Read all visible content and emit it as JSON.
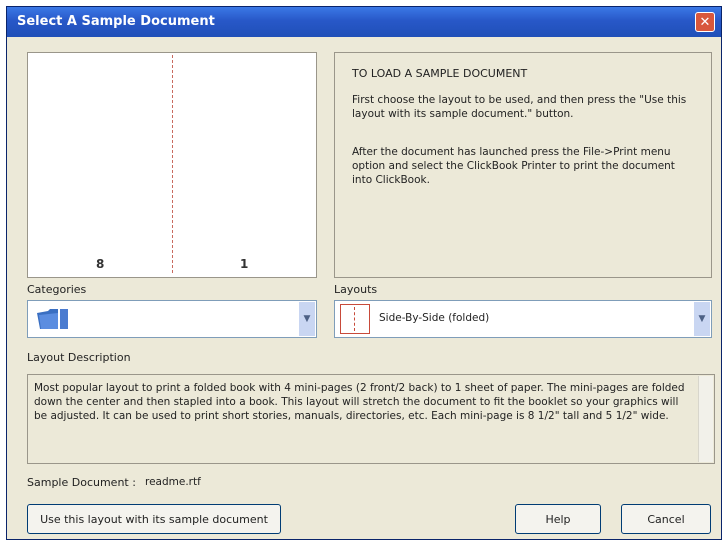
{
  "window": {
    "title": "Select A Sample Document",
    "close_glyph": "✕"
  },
  "preview": {
    "page_left": "8",
    "page_right": "1"
  },
  "info": {
    "heading": "TO LOAD A SAMPLE DOCUMENT",
    "para1": "First choose the layout to be used, and then press the \"Use this layout with its sample document.\" button.",
    "para2": "After the document has launched press the File->Print menu option and select the ClickBook Printer to print the document into ClickBook."
  },
  "categories": {
    "label": "Categories",
    "selected": "",
    "icon": "folder-icon"
  },
  "layouts": {
    "label": "Layouts",
    "selected": "Side-By-Side (folded)",
    "icon": "layout-thumbnail-icon"
  },
  "description": {
    "label": "Layout Description",
    "text": "Most popular layout to print a folded book with 4 mini-pages (2 front/2 back) to 1 sheet of paper. The mini-pages are folded down the center and then stapled into a book.  This layout will stretch the document to fit the booklet so your graphics will be adjusted.  It can be used to print short stories, manuals, directories, etc.  Each mini-page is 8 1/2\" tall and 5 1/2\" wide."
  },
  "sample_document": {
    "label": "Sample Document :",
    "value": "readme.rtf"
  },
  "buttons": {
    "use_layout": "Use this layout with its sample document",
    "help": "Help",
    "cancel": "Cancel"
  },
  "colors": {
    "titlebar": "#2858c8",
    "dialog_bg": "#ece9d8",
    "close_button": "#d8573c"
  }
}
